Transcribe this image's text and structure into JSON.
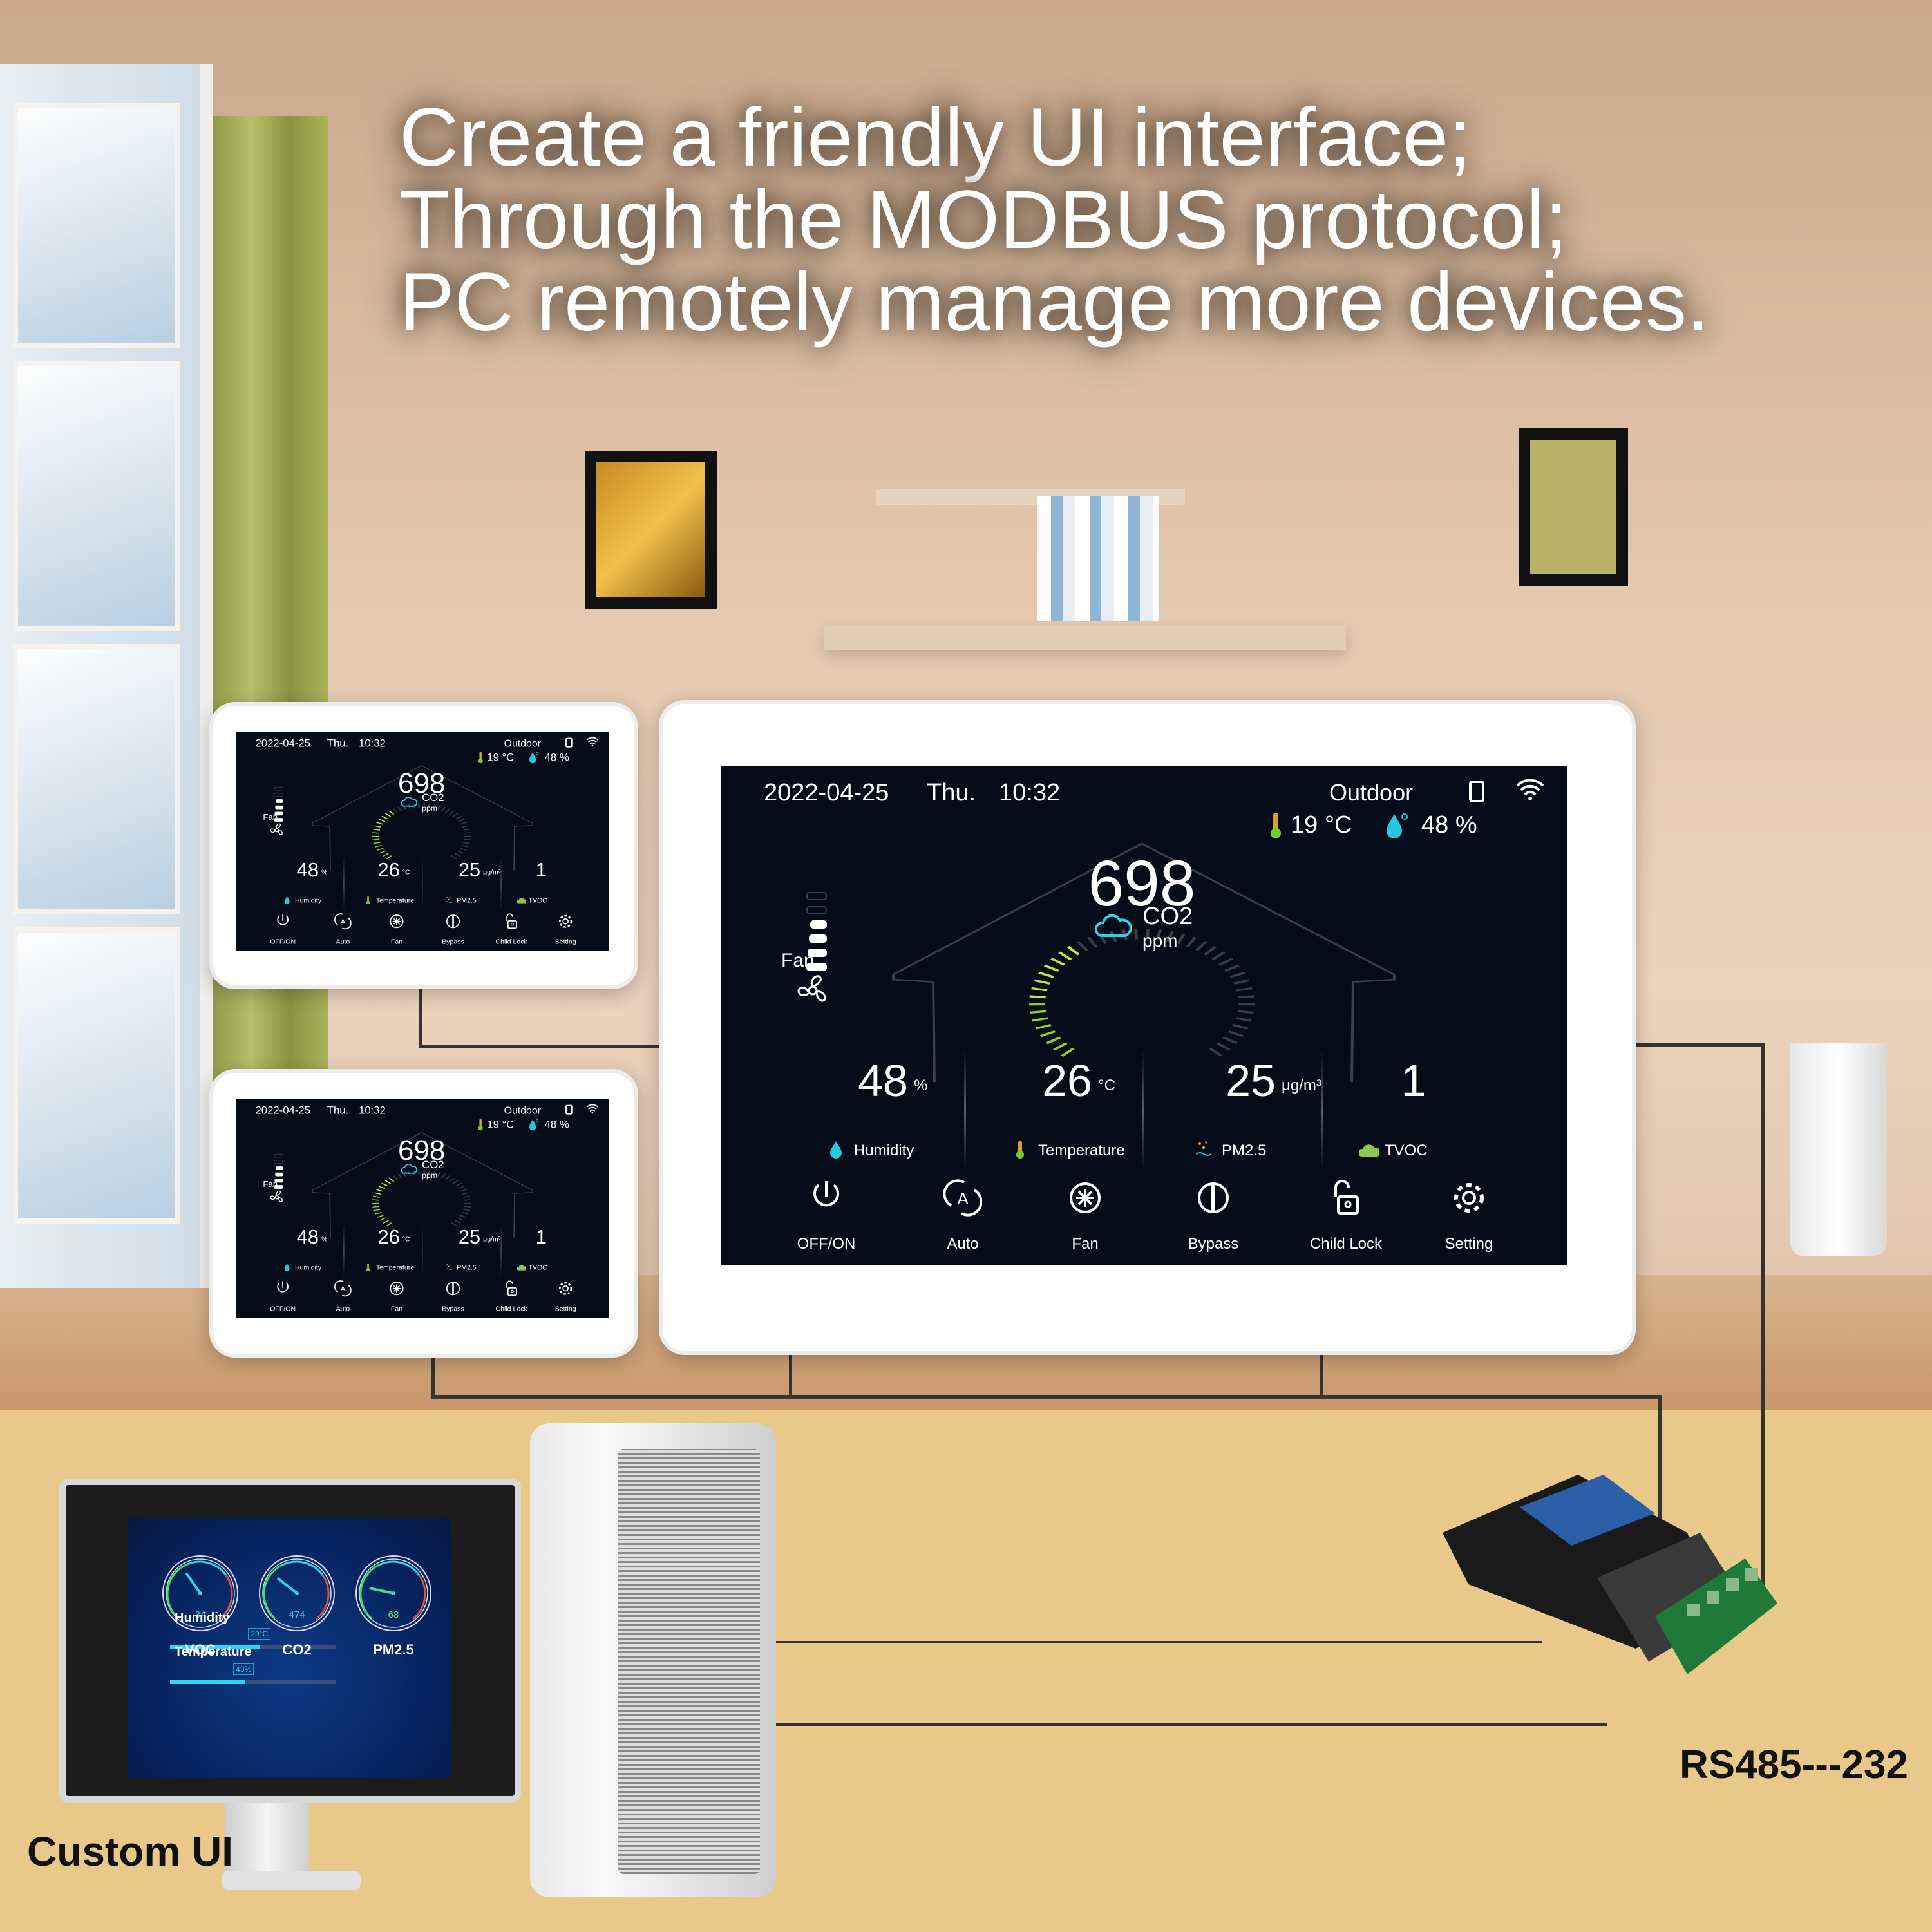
{
  "headline": [
    "Create a friendly UI interface;",
    "Through the MODBUS protocol;",
    "PC remotely manage more devices."
  ],
  "device": {
    "date": "2022-04-25",
    "weekday": "Thu.",
    "time": "10:32",
    "outdoor_label": "Outdoor",
    "outdoor_temp": "19 °C",
    "outdoor_humidity": "48 %",
    "fan_label": "Fan",
    "fan_level": 4,
    "fan_levels_total": 6,
    "co2": {
      "value": "698",
      "label": "CO2",
      "unit": "ppm",
      "gauge_fraction": 0.36
    },
    "stats": [
      {
        "value": "48",
        "unit": "%",
        "label": "Humidity",
        "icon": "droplet-icon"
      },
      {
        "value": "26",
        "unit": "°C",
        "label": "Temperature",
        "icon": "thermometer-icon"
      },
      {
        "value": "25",
        "unit": "μg/m³",
        "label": "PM2.5",
        "icon": "particles-icon"
      },
      {
        "value": "1",
        "unit": "",
        "label": "TVOC",
        "icon": "voc-cloud-icon"
      }
    ],
    "buttons": [
      {
        "label": "OFF/ON",
        "icon": "power-icon"
      },
      {
        "label": "Auto",
        "icon": "auto-mode-icon"
      },
      {
        "label": "Fan",
        "icon": "fan-icon"
      },
      {
        "label": "Bypass",
        "icon": "bypass-icon"
      },
      {
        "label": "Child Lock",
        "icon": "lock-icon"
      },
      {
        "label": "Setting",
        "icon": "gear-icon"
      }
    ],
    "colors": {
      "screen_bg": "#050b18",
      "gauge_active": "#a8e020",
      "accent": "#2fd3e0"
    }
  },
  "pc_ui": {
    "gauges": [
      {
        "label": "VOC",
        "value": "34"
      },
      {
        "label": "CO2",
        "value": "474"
      },
      {
        "label": "PM2.5",
        "value": "68"
      }
    ],
    "bars": [
      {
        "label": "Humidity",
        "value": "29°C",
        "fraction": 0.54
      },
      {
        "label": "Temperature",
        "value": "43%",
        "fraction": 0.45
      }
    ]
  },
  "captions": {
    "custom_ui": "Custom UI",
    "converter": "RS485---232"
  }
}
